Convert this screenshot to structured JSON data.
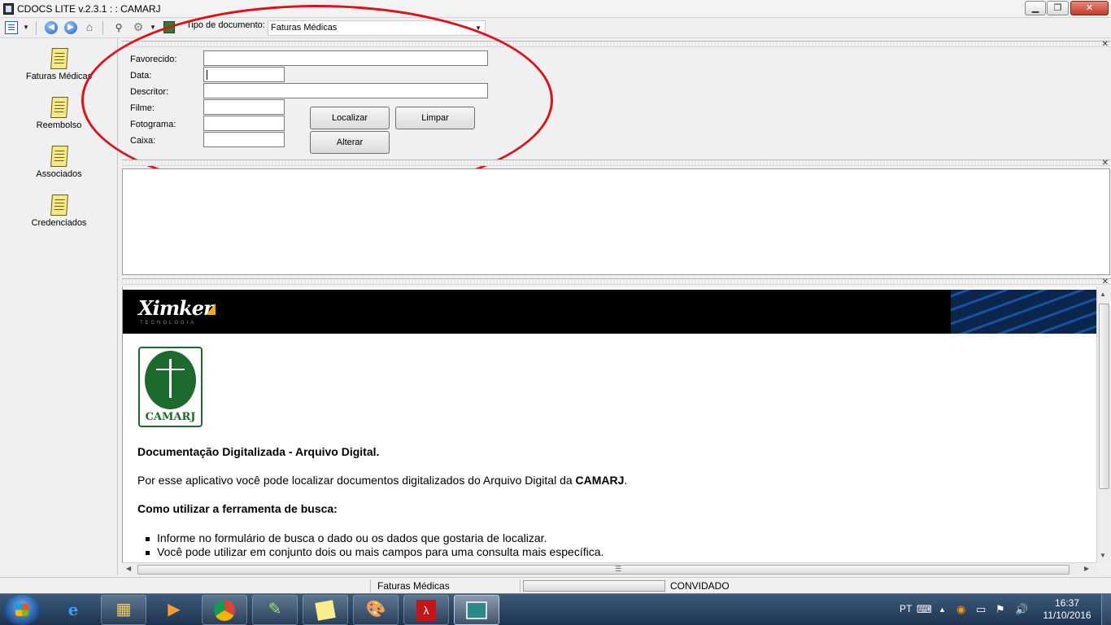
{
  "window": {
    "title": "CDOCS LITE v.2.3.1 : : CAMARJ",
    "min_label": "▁",
    "max_label": "❐",
    "close_label": "✕"
  },
  "toolbar": {
    "doc_type_label": "Tipo de documento:",
    "doc_type_value": "Faturas Médicas",
    "icons": [
      "view-menu-icon",
      "back-icon",
      "forward-icon",
      "home-icon",
      "key-icon",
      "gear-icon",
      "exit-icon"
    ]
  },
  "sidebar": {
    "items": [
      {
        "label": "Faturas Médicas",
        "icon": "document-icon"
      },
      {
        "label": "Reembolso",
        "icon": "document-icon"
      },
      {
        "label": "Associados",
        "icon": "document-icon"
      },
      {
        "label": "Credenciados",
        "icon": "document-icon"
      }
    ]
  },
  "search_form": {
    "favorecido_label": "Favorecido:",
    "data_label": "Data:",
    "descritor_label": "Descritor:",
    "filme_label": "Filme:",
    "fotograma_label": "Fotograma:",
    "caixa_label": "Caixa:",
    "favorecido_value": "",
    "data_value": "",
    "descritor_value": "",
    "filme_value": "",
    "fotograma_value": "",
    "caixa_value": "",
    "localizar_button": "Localizar",
    "limpar_button": "Limpar",
    "alterar_button": "Alterar"
  },
  "panel": {
    "close_label": "✕"
  },
  "browser": {
    "brand": "Ximker",
    "brand_subtitle": "TECNOLOGIA",
    "logo_text": "CAMARJ",
    "heading": "Documentação Digitalizada - Arquivo Digital.",
    "intro_prefix": "Por esse aplicativo você pode localizar documentos digitalizados do Arquivo Digital da ",
    "intro_bold": "CAMARJ",
    "intro_suffix": ".",
    "howto_heading": "Como utilizar a ferramenta de busca:",
    "bullets": [
      "Informe no formulário de busca o dado ou os dados que gostaria de localizar.",
      "Você pode utilizar em conjunto dois ou mais campos para uma consulta mais específica."
    ]
  },
  "status": {
    "document_type": "Faturas Médicas",
    "user": "CONVIDADO",
    "progress": 0
  },
  "taskbar": {
    "apps": [
      "internet-explorer-icon",
      "file-explorer-icon",
      "media-player-icon",
      "chrome-icon",
      "notepad-plus-icon",
      "sticky-notes-icon",
      "paint-icon",
      "acrobat-icon",
      "cdocs-app-icon"
    ],
    "language": "PT",
    "time": "16:37",
    "date": "11/10/2016"
  },
  "colors": {
    "annotation_ellipse": "#e0101a",
    "logo_green": "#1c6b2c",
    "brand_orange": "#f5a623",
    "close_red": "#c13a28"
  }
}
